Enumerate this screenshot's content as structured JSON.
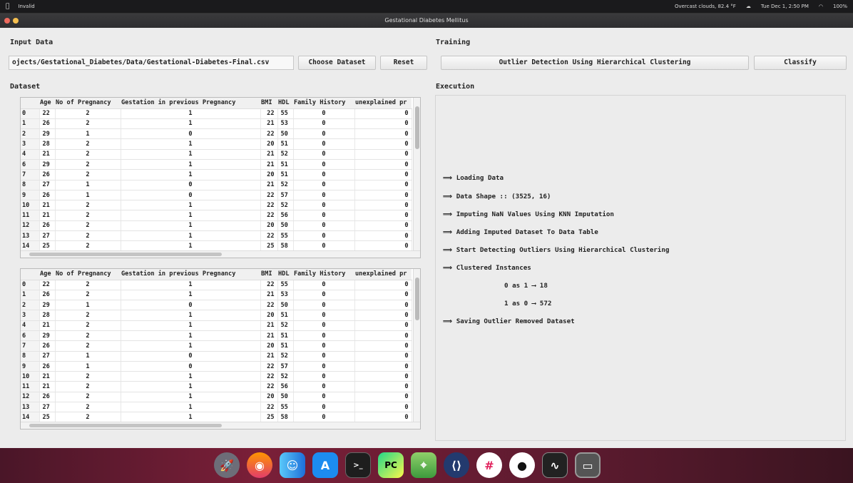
{
  "menubar": {
    "app_name": "Invalid",
    "weather": "Overcast clouds, 82.4 °F",
    "datetime": "Tue Dec 1, 2:50 PM",
    "battery": "100%"
  },
  "window": {
    "title": "Gestational Diabetes Mellitus"
  },
  "input_data": {
    "label": "Input Data",
    "path_value": "ojects/Gestational_Diabetes/Data/Gestational-Diabetes-Final.csv",
    "choose_button": "Choose Dataset",
    "reset_button": "Reset"
  },
  "training": {
    "label": "Training",
    "outlier_button": "Outlier Detection Using Hierarchical Clustering",
    "classify_button": "Classify"
  },
  "dataset": {
    "label": "Dataset",
    "columns": [
      "",
      "Age",
      "No of Pregnancy",
      "Gestation in previous Pregnancy",
      "BMI",
      "HDL",
      "Family History",
      "unexplained pr"
    ],
    "rows": [
      [
        "0",
        "22",
        "2",
        "1",
        "22",
        "55",
        "0",
        "0"
      ],
      [
        "1",
        "26",
        "2",
        "1",
        "21",
        "53",
        "0",
        "0"
      ],
      [
        "2",
        "29",
        "1",
        "0",
        "22",
        "50",
        "0",
        "0"
      ],
      [
        "3",
        "28",
        "2",
        "1",
        "20",
        "51",
        "0",
        "0"
      ],
      [
        "4",
        "21",
        "2",
        "1",
        "21",
        "52",
        "0",
        "0"
      ],
      [
        "6",
        "29",
        "2",
        "1",
        "21",
        "51",
        "0",
        "0"
      ],
      [
        "7",
        "26",
        "2",
        "1",
        "20",
        "51",
        "0",
        "0"
      ],
      [
        "8",
        "27",
        "1",
        "0",
        "21",
        "52",
        "0",
        "0"
      ],
      [
        "9",
        "26",
        "1",
        "0",
        "22",
        "57",
        "0",
        "0"
      ],
      [
        "10",
        "21",
        "2",
        "1",
        "22",
        "52",
        "0",
        "0"
      ],
      [
        "11",
        "21",
        "2",
        "1",
        "22",
        "56",
        "0",
        "0"
      ],
      [
        "12",
        "26",
        "2",
        "1",
        "20",
        "50",
        "0",
        "0"
      ],
      [
        "13",
        "27",
        "2",
        "1",
        "22",
        "55",
        "0",
        "0"
      ],
      [
        "14",
        "25",
        "2",
        "1",
        "25",
        "58",
        "0",
        "0"
      ]
    ]
  },
  "execution": {
    "label": "Execution",
    "log": [
      "⟹ Loading Data",
      "⟹ Data Shape :: (3525, 16)",
      "⟹ Imputing NaN Values Using KNN Imputation",
      "⟹ Adding Imputed Dataset To Data Table",
      "⟹ Start Detecting Outliers Using Hierarchical Clustering",
      "⟹ Clustered Instances"
    ],
    "clusters": [
      "0 as 1 ⟶ 18",
      "1 as 0 ⟶ 572"
    ],
    "final": "⟹ Saving Outlier Removed Dataset"
  },
  "dock": {
    "icons": [
      "launchpad-icon",
      "firefox-icon",
      "finder-icon",
      "appstore-icon",
      "terminal-icon",
      "pycharm-icon",
      "maps-icon",
      "slack-icon",
      "github-icon",
      "activity-monitor-icon",
      "app-window-icon"
    ]
  }
}
